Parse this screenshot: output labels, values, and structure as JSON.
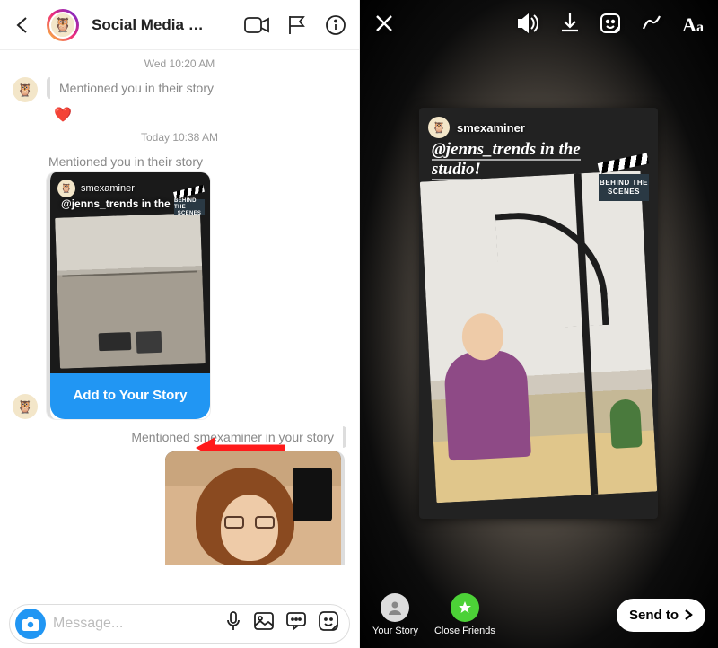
{
  "dm": {
    "chat_name": "Social Media …",
    "timestamps": {
      "t1": "Wed 10:20 AM",
      "t2": "Today 10:38 AM"
    },
    "mention_in_1": "Mentioned you in their story",
    "mention_in_2": "Mentioned you in their story",
    "mention_out": "Mentioned smexaminer in your story",
    "heart_reaction": "❤️",
    "story_preview": {
      "username": "smexaminer",
      "caption": "@jenns_trends in the",
      "sticker_line1": "BEHIND THE",
      "sticker_line2": "SCENES"
    },
    "add_to_story_button": "Add to Your Story",
    "composer_placeholder": "Message..."
  },
  "editor": {
    "shared_story": {
      "username": "smexaminer",
      "caption": "@jenns_trends in the studio!",
      "sticker_line1": "BEHIND THE",
      "sticker_line2": "SCENES"
    },
    "text_tool": "Aa",
    "destinations": {
      "your_story": "Your Story",
      "close_friends": "Close Friends"
    },
    "send_to": "Send to"
  },
  "avatar_emoji": "🦉"
}
